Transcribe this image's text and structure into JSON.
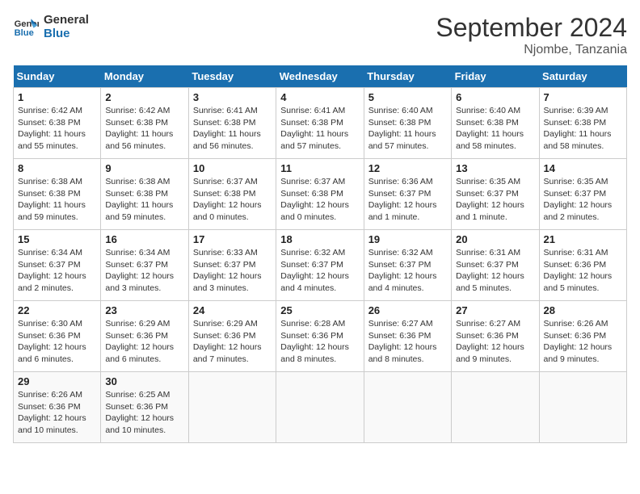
{
  "logo": {
    "line1": "General",
    "line2": "Blue"
  },
  "title": "September 2024",
  "location": "Njombe, Tanzania",
  "weekdays": [
    "Sunday",
    "Monday",
    "Tuesday",
    "Wednesday",
    "Thursday",
    "Friday",
    "Saturday"
  ],
  "weeks": [
    [
      {
        "day": "1",
        "sunrise": "6:42 AM",
        "sunset": "6:38 PM",
        "daylight": "11 hours and 55 minutes."
      },
      {
        "day": "2",
        "sunrise": "6:42 AM",
        "sunset": "6:38 PM",
        "daylight": "11 hours and 56 minutes."
      },
      {
        "day": "3",
        "sunrise": "6:41 AM",
        "sunset": "6:38 PM",
        "daylight": "11 hours and 56 minutes."
      },
      {
        "day": "4",
        "sunrise": "6:41 AM",
        "sunset": "6:38 PM",
        "daylight": "11 hours and 57 minutes."
      },
      {
        "day": "5",
        "sunrise": "6:40 AM",
        "sunset": "6:38 PM",
        "daylight": "11 hours and 57 minutes."
      },
      {
        "day": "6",
        "sunrise": "6:40 AM",
        "sunset": "6:38 PM",
        "daylight": "11 hours and 58 minutes."
      },
      {
        "day": "7",
        "sunrise": "6:39 AM",
        "sunset": "6:38 PM",
        "daylight": "11 hours and 58 minutes."
      }
    ],
    [
      {
        "day": "8",
        "sunrise": "6:38 AM",
        "sunset": "6:38 PM",
        "daylight": "11 hours and 59 minutes."
      },
      {
        "day": "9",
        "sunrise": "6:38 AM",
        "sunset": "6:38 PM",
        "daylight": "11 hours and 59 minutes."
      },
      {
        "day": "10",
        "sunrise": "6:37 AM",
        "sunset": "6:38 PM",
        "daylight": "12 hours and 0 minutes."
      },
      {
        "day": "11",
        "sunrise": "6:37 AM",
        "sunset": "6:38 PM",
        "daylight": "12 hours and 0 minutes."
      },
      {
        "day": "12",
        "sunrise": "6:36 AM",
        "sunset": "6:37 PM",
        "daylight": "12 hours and 1 minute."
      },
      {
        "day": "13",
        "sunrise": "6:35 AM",
        "sunset": "6:37 PM",
        "daylight": "12 hours and 1 minute."
      },
      {
        "day": "14",
        "sunrise": "6:35 AM",
        "sunset": "6:37 PM",
        "daylight": "12 hours and 2 minutes."
      }
    ],
    [
      {
        "day": "15",
        "sunrise": "6:34 AM",
        "sunset": "6:37 PM",
        "daylight": "12 hours and 2 minutes."
      },
      {
        "day": "16",
        "sunrise": "6:34 AM",
        "sunset": "6:37 PM",
        "daylight": "12 hours and 3 minutes."
      },
      {
        "day": "17",
        "sunrise": "6:33 AM",
        "sunset": "6:37 PM",
        "daylight": "12 hours and 3 minutes."
      },
      {
        "day": "18",
        "sunrise": "6:32 AM",
        "sunset": "6:37 PM",
        "daylight": "12 hours and 4 minutes."
      },
      {
        "day": "19",
        "sunrise": "6:32 AM",
        "sunset": "6:37 PM",
        "daylight": "12 hours and 4 minutes."
      },
      {
        "day": "20",
        "sunrise": "6:31 AM",
        "sunset": "6:37 PM",
        "daylight": "12 hours and 5 minutes."
      },
      {
        "day": "21",
        "sunrise": "6:31 AM",
        "sunset": "6:36 PM",
        "daylight": "12 hours and 5 minutes."
      }
    ],
    [
      {
        "day": "22",
        "sunrise": "6:30 AM",
        "sunset": "6:36 PM",
        "daylight": "12 hours and 6 minutes."
      },
      {
        "day": "23",
        "sunrise": "6:29 AM",
        "sunset": "6:36 PM",
        "daylight": "12 hours and 6 minutes."
      },
      {
        "day": "24",
        "sunrise": "6:29 AM",
        "sunset": "6:36 PM",
        "daylight": "12 hours and 7 minutes."
      },
      {
        "day": "25",
        "sunrise": "6:28 AM",
        "sunset": "6:36 PM",
        "daylight": "12 hours and 8 minutes."
      },
      {
        "day": "26",
        "sunrise": "6:27 AM",
        "sunset": "6:36 PM",
        "daylight": "12 hours and 8 minutes."
      },
      {
        "day": "27",
        "sunrise": "6:27 AM",
        "sunset": "6:36 PM",
        "daylight": "12 hours and 9 minutes."
      },
      {
        "day": "28",
        "sunrise": "6:26 AM",
        "sunset": "6:36 PM",
        "daylight": "12 hours and 9 minutes."
      }
    ],
    [
      {
        "day": "29",
        "sunrise": "6:26 AM",
        "sunset": "6:36 PM",
        "daylight": "12 hours and 10 minutes."
      },
      {
        "day": "30",
        "sunrise": "6:25 AM",
        "sunset": "6:36 PM",
        "daylight": "12 hours and 10 minutes."
      },
      null,
      null,
      null,
      null,
      null
    ]
  ]
}
